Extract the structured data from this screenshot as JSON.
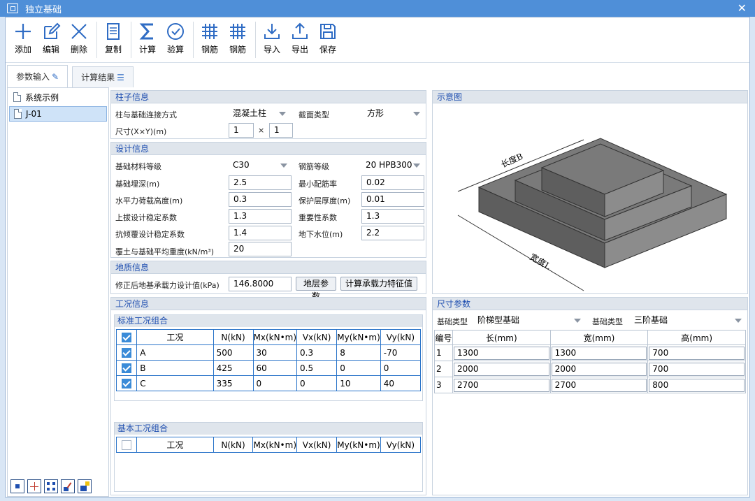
{
  "window": {
    "title": "独立基础"
  },
  "toolbar": {
    "add": "添加",
    "edit": "编辑",
    "delete": "删除",
    "copy": "复制",
    "calc": "计算",
    "check": "验算",
    "rebar1": "钢筋",
    "rebar2": "钢筋",
    "import": "导入",
    "export": "导出",
    "save": "保存"
  },
  "tabs": {
    "input": "参数输入",
    "result": "计算结果"
  },
  "tree": {
    "items": [
      "系统示例",
      "J-01"
    ]
  },
  "column_info": {
    "title": "柱子信息",
    "conn_label": "柱与基础连接方式",
    "conn_value": "混凝土柱",
    "section_label": "截面类型",
    "section_value": "方形",
    "size_label": "尺寸(X×Y)(m)",
    "size_x": "1",
    "size_sep": "×",
    "size_y": "1"
  },
  "design_info": {
    "title": "设计信息",
    "material_label": "基础材料等级",
    "material_value": "C30",
    "rebar_label": "钢筋等级",
    "rebar_value": "20 HPB300",
    "depth_label": "基础埋深(m)",
    "depth_value": "2.5",
    "min_ratio_label": "最小配筋率",
    "min_ratio_value": "0.02",
    "load_height_label": "水平力荷载高度(m)",
    "load_height_value": "0.3",
    "cover_label": "保护层厚度(m)",
    "cover_value": "0.01",
    "uplift_label": "上拔设计稳定系数",
    "uplift_value": "1.3",
    "importance_label": "重要性系数",
    "importance_value": "1.3",
    "overturn_label": "抗倾覆设计稳定系数",
    "overturn_value": "1.4",
    "water_label": "地下水位(m)",
    "water_value": "2.2",
    "soil_weight_label": "覆土与基础平均重度(kN/m³)",
    "soil_weight_value": "20"
  },
  "geo_info": {
    "title": "地质信息",
    "bearing_label": "修正后地基承载力设计值(kPa)",
    "bearing_value": "146.8000",
    "layer_btn": "地层参数",
    "calc_btn": "计算承载力特征值"
  },
  "conditions": {
    "title": "工况信息",
    "standard": {
      "title": "标准工况组合",
      "headers": [
        "工况",
        "N(kN)",
        "Mx(kN•m)",
        "Vx(kN)",
        "My(kN•m)",
        "Vy(kN)"
      ],
      "rows": [
        {
          "name": "A",
          "N": "500",
          "Mx": "30",
          "Vx": "0.3",
          "My": "8",
          "Vy": "-70"
        },
        {
          "name": "B",
          "N": "425",
          "Mx": "60",
          "Vx": "0.5",
          "My": "0",
          "Vy": "0"
        },
        {
          "name": "C",
          "N": "335",
          "Mx": "0",
          "Vx": "0",
          "My": "10",
          "Vy": "40"
        }
      ]
    },
    "basic": {
      "title": "基本工况组合",
      "headers": [
        "工况",
        "N(kN)",
        "Mx(kN•m)",
        "Vx(kN)",
        "My(kN•m)",
        "Vy(kN)"
      ]
    }
  },
  "diagram": {
    "title": "示意图",
    "length_label": "长度B",
    "width_label": "宽度L"
  },
  "dimensions": {
    "title": "尺寸参数",
    "type_label": "基础类型",
    "type_value": "阶梯型基础",
    "type2_label": "基础类型",
    "type2_value": "三阶基础",
    "headers": [
      "编号",
      "长(mm)",
      "宽(mm)",
      "高(mm)"
    ],
    "rows": [
      {
        "no": "1",
        "l": "1300",
        "w": "1300",
        "h": "700"
      },
      {
        "no": "2",
        "l": "2000",
        "w": "2000",
        "h": "700"
      },
      {
        "no": "3",
        "l": "2700",
        "w": "2700",
        "h": "800"
      }
    ]
  },
  "colors": {
    "titlebar": "#4f8fd8",
    "accent": "#2a74c9",
    "section_text": "#1f4fb0"
  }
}
